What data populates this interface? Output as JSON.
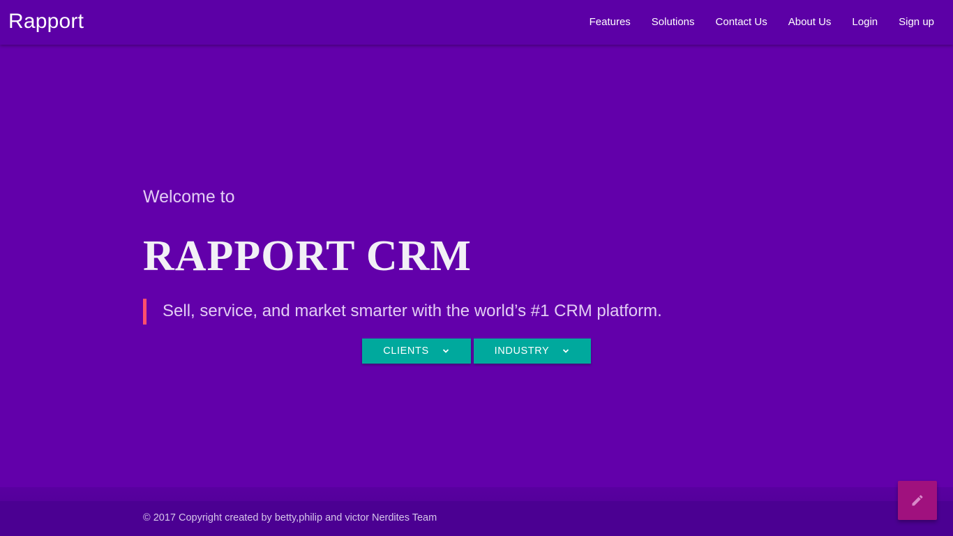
{
  "navbar": {
    "brand": "Rapport",
    "links": [
      {
        "label": "Features"
      },
      {
        "label": "Solutions"
      },
      {
        "label": "Contact Us"
      },
      {
        "label": "About Us"
      },
      {
        "label": "Login"
      },
      {
        "label": "Sign up"
      }
    ]
  },
  "hero": {
    "welcome": "Welcome to",
    "title": "RAPPORT CRM",
    "tagline": "Sell, service, and market smarter with the world’s #1 CRM platform.",
    "buttons": [
      {
        "label": "CLIENTS",
        "icon": "chevron-down-icon"
      },
      {
        "label": "INDUSTRY",
        "icon": "chevron-down-icon"
      }
    ]
  },
  "footer": {
    "copyright": "© 2017 Copyright created by betty,philip and victor Nerdites Team"
  },
  "fab": {
    "icon": "pencil-icon"
  },
  "colors": {
    "background": "#6200aa",
    "navbar": "#5c00a6",
    "button": "#00a99d",
    "accent_border": "#ff4f6d",
    "fab": "#a0117e",
    "footer": "#4b0092"
  }
}
